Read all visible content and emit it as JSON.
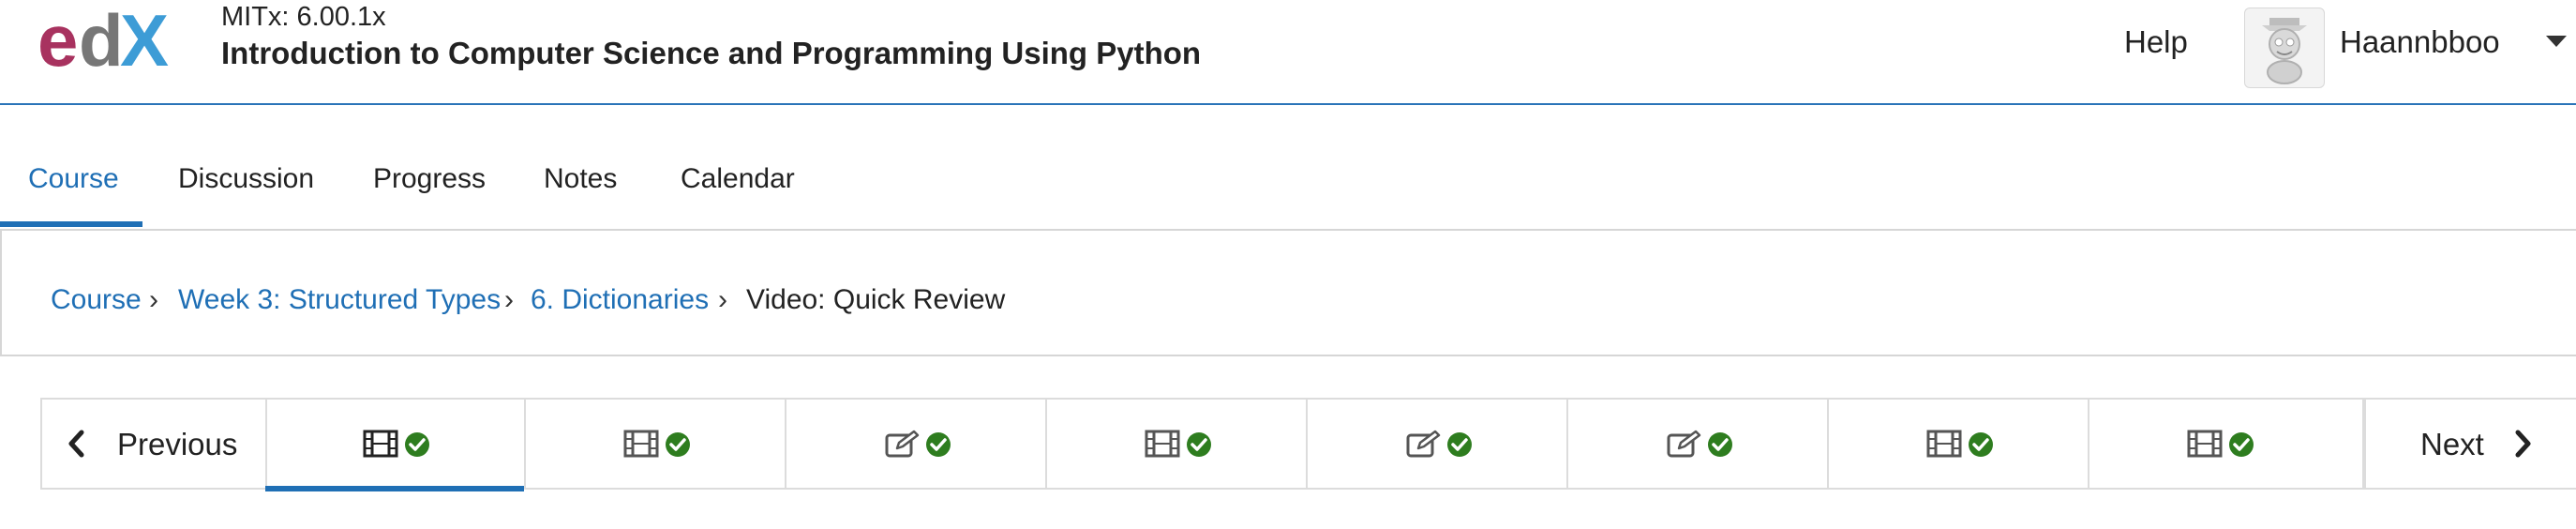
{
  "header": {
    "logo": {
      "name": "edX"
    },
    "course_code": "MITx: 6.00.1x",
    "course_title": "Introduction to Computer Science and Programming Using Python",
    "help_label": "Help",
    "username": "Haannbboo"
  },
  "tabs": [
    {
      "label": "Course",
      "active": true
    },
    {
      "label": "Discussion",
      "active": false
    },
    {
      "label": "Progress",
      "active": false
    },
    {
      "label": "Notes",
      "active": false
    },
    {
      "label": "Calendar",
      "active": false
    }
  ],
  "breadcrumb": [
    {
      "label": "Course",
      "link": true
    },
    {
      "label": "Week 3: Structured Types",
      "link": true
    },
    {
      "label": "6. Dictionaries",
      "link": true
    },
    {
      "label": "Video: Quick Review",
      "link": false
    }
  ],
  "breadcrumb_separator": "›",
  "sequence": {
    "previous_label": "Previous",
    "next_label": "Next",
    "units": [
      {
        "icon": "video-icon",
        "complete": true,
        "active": true
      },
      {
        "icon": "video-icon",
        "complete": true,
        "active": false
      },
      {
        "icon": "problem-edit-icon",
        "complete": true,
        "active": false
      },
      {
        "icon": "video-icon",
        "complete": true,
        "active": false
      },
      {
        "icon": "problem-edit-icon",
        "complete": true,
        "active": false
      },
      {
        "icon": "problem-edit-icon",
        "complete": true,
        "active": false
      },
      {
        "icon": "video-icon",
        "complete": true,
        "active": false
      },
      {
        "icon": "video-icon",
        "complete": true,
        "active": false
      }
    ]
  },
  "colors": {
    "accent": "#1f6fb5",
    "check": "#2e7d1f",
    "logo_magenta": "#a8325f",
    "logo_gray": "#666666",
    "logo_blue": "#3d9cd6"
  }
}
